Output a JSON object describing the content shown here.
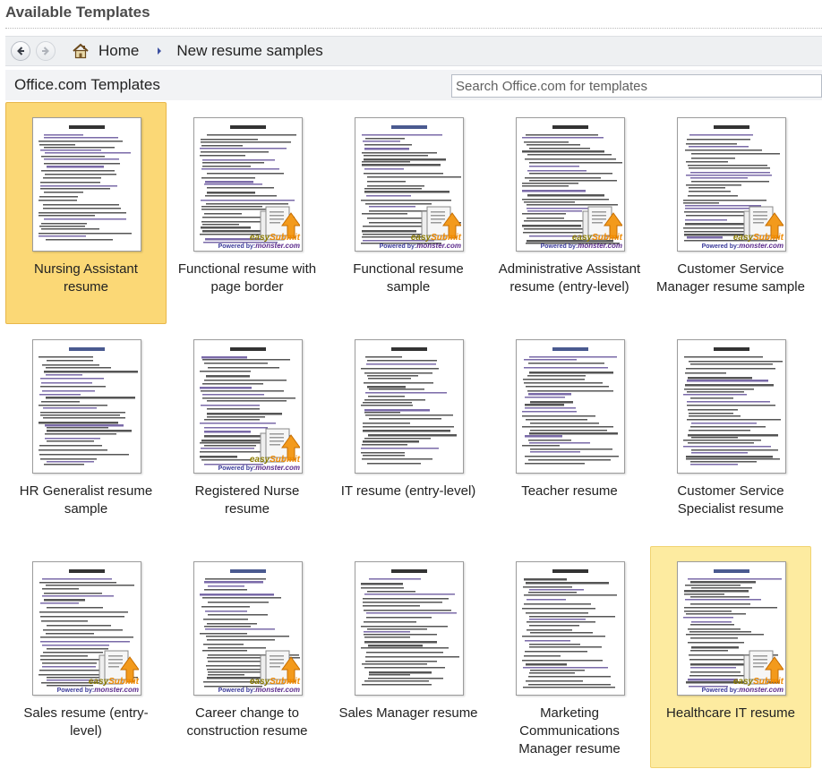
{
  "window": {
    "title": "Available Templates"
  },
  "nav": {
    "back_icon": "back-arrow-icon",
    "forward_icon": "forward-arrow-icon",
    "home_icon": "home-icon",
    "home_label": "Home",
    "breadcrumb_current": "New resume samples"
  },
  "office": {
    "title": "Office.com Templates",
    "search_placeholder": "Search Office.com for templates"
  },
  "brand": {
    "easy": "easy",
    "submit": "Submit",
    "powered": "Powered by:",
    "monster": "monster.com"
  },
  "templates": [
    {
      "label": "Nursing Assistant resume",
      "state": "selected",
      "badge": false
    },
    {
      "label": "Functional resume with page border",
      "state": "normal",
      "badge": true
    },
    {
      "label": "Functional resume sample",
      "state": "normal",
      "badge": true
    },
    {
      "label": "Administrative Assistant resume (entry-level)",
      "state": "normal",
      "badge": true
    },
    {
      "label": "Customer Service Manager resume sample",
      "state": "normal",
      "badge": true
    },
    {
      "label": "HR Generalist resume sample",
      "state": "normal",
      "badge": false
    },
    {
      "label": "Registered Nurse resume",
      "state": "normal",
      "badge": true
    },
    {
      "label": "IT resume (entry-level)",
      "state": "normal",
      "badge": false
    },
    {
      "label": "Teacher resume",
      "state": "normal",
      "badge": false
    },
    {
      "label": "Customer Service Specialist resume",
      "state": "normal",
      "badge": false
    },
    {
      "label": "Sales resume (entry-level)",
      "state": "normal",
      "badge": true
    },
    {
      "label": "Career change to construction resume",
      "state": "normal",
      "badge": true
    },
    {
      "label": "Sales Manager resume",
      "state": "normal",
      "badge": false
    },
    {
      "label": "Marketing Communications Manager resume",
      "state": "normal",
      "badge": false
    },
    {
      "label": "Healthcare IT resume",
      "state": "hovered",
      "badge": true
    }
  ],
  "colors": {
    "selected": "#fbd876",
    "hovered": "#fdeba0",
    "accent_orange": "#f08a00"
  }
}
